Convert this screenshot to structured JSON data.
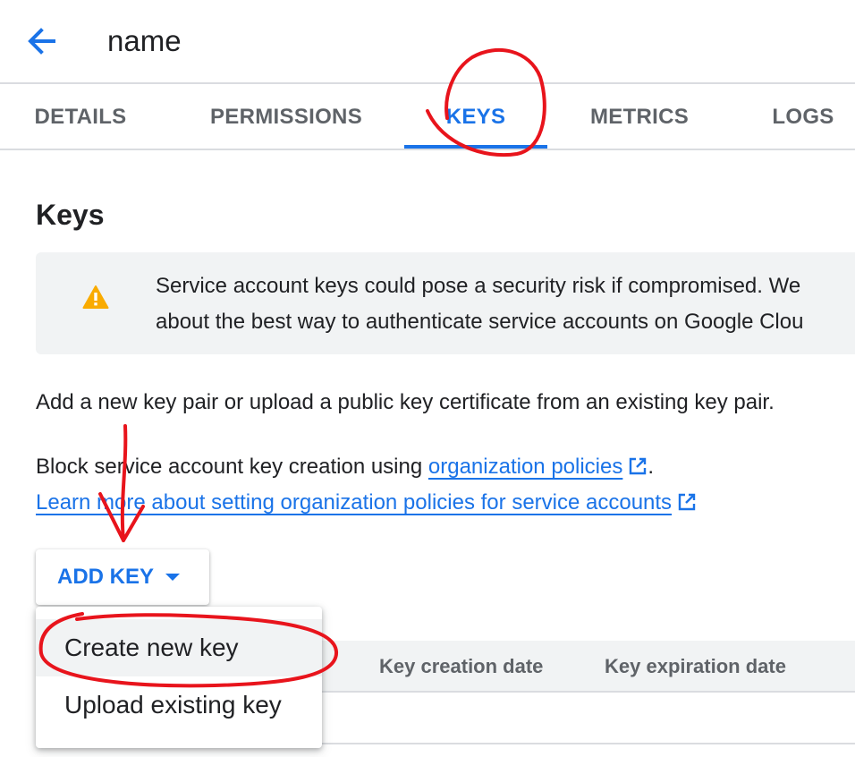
{
  "header": {
    "title": "name",
    "back_icon": "arrow-left-icon"
  },
  "tabs": [
    {
      "label": "DETAILS",
      "active": false
    },
    {
      "label": "PERMISSIONS",
      "active": false
    },
    {
      "label": "KEYS",
      "active": true
    },
    {
      "label": "METRICS",
      "active": false
    },
    {
      "label": "LOGS",
      "active": false
    }
  ],
  "keys": {
    "title": "Keys",
    "warning": {
      "icon": "warning-icon",
      "line1": "Service account keys could pose a security risk if compromised. We",
      "line2": "about the best way to authenticate service accounts on Google Clou"
    },
    "intro": "Add a new key pair or upload a public key certificate from an existing key pair.",
    "block_prefix": "Block service account key creation using ",
    "block_link": "organization policies",
    "block_suffix": ".",
    "learn_link": "Learn more about setting organization policies for service accounts",
    "add_key_label": "ADD KEY"
  },
  "menu": {
    "items": [
      "Create new key",
      "Upload existing key"
    ]
  },
  "table": {
    "columns": [
      "Key creation date",
      "Key expiration date"
    ]
  },
  "colors": {
    "accent": "#1a73e8",
    "annotation": "#e8141c",
    "warning": "#f9ab00"
  }
}
